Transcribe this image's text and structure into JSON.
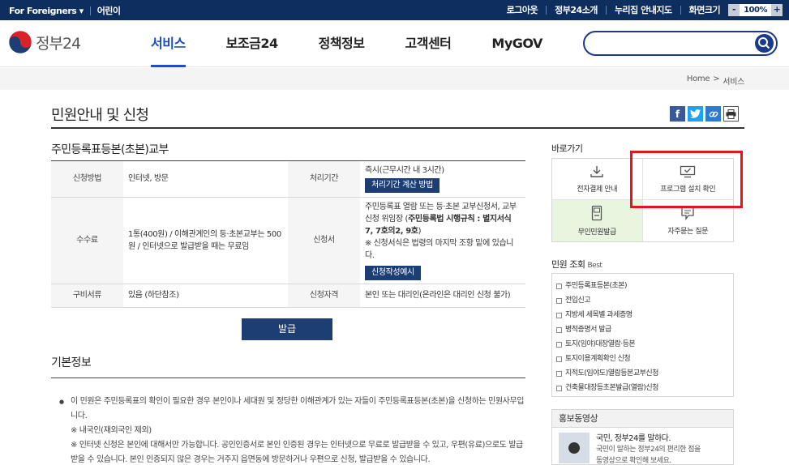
{
  "topbar": {
    "foreigners": "For Foreigners",
    "foreigners_caret": "▾",
    "kids": "어린이",
    "logout": "로그아웃",
    "time": "정부24소개",
    "sitemap": "누리집 안내지도",
    "screen": "화면크기",
    "zoom_minus": "-",
    "zoom_value": "100%",
    "zoom_plus": "+"
  },
  "header": {
    "logo": "정부24",
    "nav": [
      "서비스",
      "보조금24",
      "정책정보",
      "고객센터",
      "MyGOV"
    ],
    "active_nav": "서비스",
    "search_placeholder": ""
  },
  "breadcrumb": {
    "home": "Home",
    "sep": ">",
    "current": "서비스"
  },
  "page": {
    "title": "민원안내 및 신청"
  },
  "service": {
    "name": "주민등록표등본(초본)교부",
    "rows": {
      "method_label": "신청방법",
      "method_value": "인터넷, 방문",
      "period_label": "처리기간",
      "period_value": "즉시(근무시간 내 3시간)",
      "period_button": "처리기간 계산 방법",
      "fee_label": "수수료",
      "fee_value": "1통(400원) / 이해관계인의 등·초본교부는 500원 / 인터넷으로 발급받을 때는 무료임",
      "form_label": "신청서",
      "form_value_1": "주민등록표 열람 또는 등·초본 교부신청서, 교부신청 위임장 (",
      "form_value_bold": "주민등록법 시행규칙 : 별지서식 7, 7호의2, 9호",
      "form_value_2": ")",
      "form_note": "※ 신청서식은 법령의 마지막 조항 밑에 있습니다.",
      "form_button": "신청작성예시",
      "docs_label": "구비서류",
      "docs_value": "있음 (하단참조)",
      "qual_label": "신청자격",
      "qual_value": "본인 또는 대리인(온라인은 대리인 신청 불가)"
    },
    "issue_button": "발급"
  },
  "basic": {
    "title": "기본정보",
    "bullet": "●",
    "line1": "이 민원은 주민등록표의 확인이 필요한 경우 본인이나 세대원 및 정당한 이해관계가 있는 자들이 주민등록표등본(초본)을 신청하는 민원사무입니다.",
    "line2": "※ 내국인(재외국인 제외)",
    "line3": "※ 인터넷 신청은 본인에 대해서만 가능합니다. 공인인증서로 본인 인증된 경우는 인터넷으로 무료로 발급받을 수 있고, 우편(유료)으로도 발급받을 수 있습니다. 본인 인증되지 않은 경우는 거주지 읍면동에 방문하거나 우편으로 신청, 발급받을 수 있습니다."
  },
  "sidebar": {
    "quick_title": "바로가기",
    "quick": [
      "전자결제 안내",
      "프로그램 설치 확인",
      "무인민원발급",
      "자주묻는 질문"
    ],
    "popular_title": "민원 조회",
    "popular_best": "Best",
    "popular": [
      "주민등록표등본(초본)",
      "전입신고",
      "지방세 세목별 과세증명",
      "병적증명서 발급",
      "토지(임야)대장열람·등본",
      "토지이용계획확인 신청",
      "지적도(임야도)열람등본교부신청",
      "건축물대장등초본발급(열람)신청"
    ],
    "promo_title": "홍보동영상",
    "promo_headline": "국민, 정부24를 말하다.",
    "promo_desc_1": "국민이 말하는 정부24의 편리한 점을",
    "promo_desc_2": "동영상으로 확인해 보세요."
  },
  "colors": {
    "navy": "#0f2e60",
    "accent": "#1d4ec2",
    "button": "#1d3e73",
    "highlight": "#e8141c",
    "green": "#e8f5df"
  }
}
